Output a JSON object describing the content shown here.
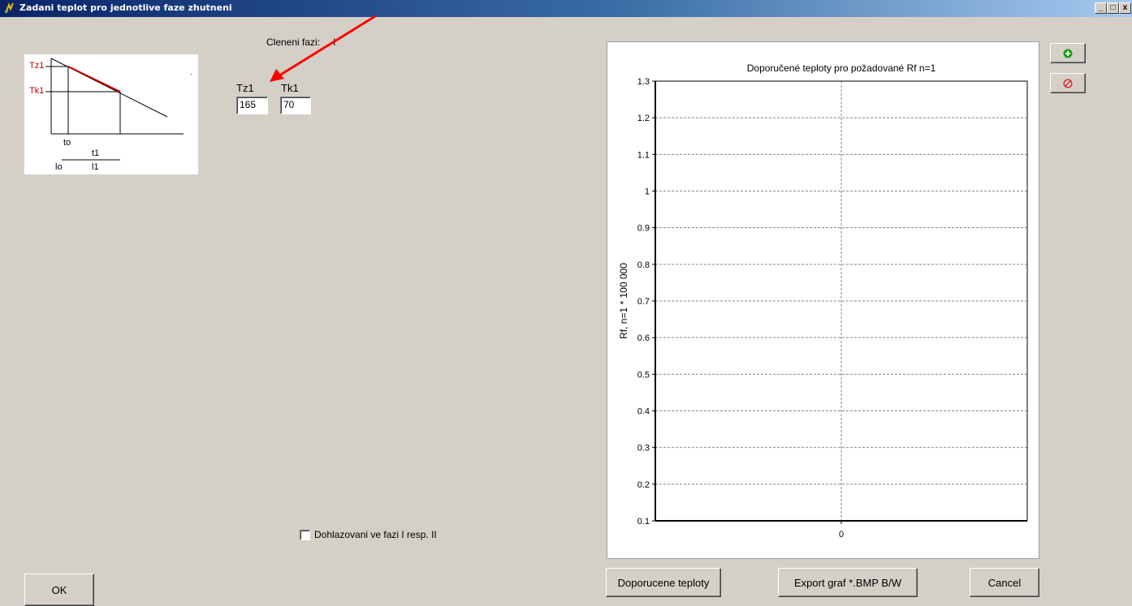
{
  "window": {
    "title": "Zadani teplot pro jednotlive faze zhutneni",
    "controls": [
      "_",
      "□",
      "x"
    ]
  },
  "sketch": {
    "tz_label": "Tz1",
    "tk_label": "Tk1",
    "to_label": "to",
    "t1_label": "t1",
    "lo_label": "lo",
    "l1_label": "l1",
    "accent_color": "#cc0000"
  },
  "phases": {
    "label": "Cleneni fazi:",
    "value": "I"
  },
  "temps": {
    "tz1_label": "Tz1",
    "tk1_label": "Tk1",
    "tz1_value": "165",
    "tk1_value": "70"
  },
  "checkbox": {
    "label": "Dohlazovani ve fazi I resp. II",
    "checked": false
  },
  "buttons": {
    "ok": "OK",
    "recommended": "Doporucene teploty",
    "export": "Export graf *.BMP B/W",
    "cancel": "Cancel",
    "add_icon": "plus-circle-icon",
    "remove_icon": "no-entry-icon"
  },
  "chart_data": {
    "type": "line",
    "title": "Doporučené teploty pro požadované Rf  n=1",
    "ylabel": "Rf, n=1 * 100 000",
    "xlabel": "",
    "ylim": [
      0.1,
      1.3
    ],
    "yticks": [
      "0.1",
      "0.2",
      "0.3",
      "0.4",
      "0.5",
      "0.6",
      "0.7",
      "0.8",
      "0.9",
      "1",
      "1.1",
      "1.2",
      "1.3"
    ],
    "xticks": [
      "0"
    ],
    "grid": true,
    "series": []
  },
  "annotation": {
    "arrow_color": "#ff0000"
  }
}
